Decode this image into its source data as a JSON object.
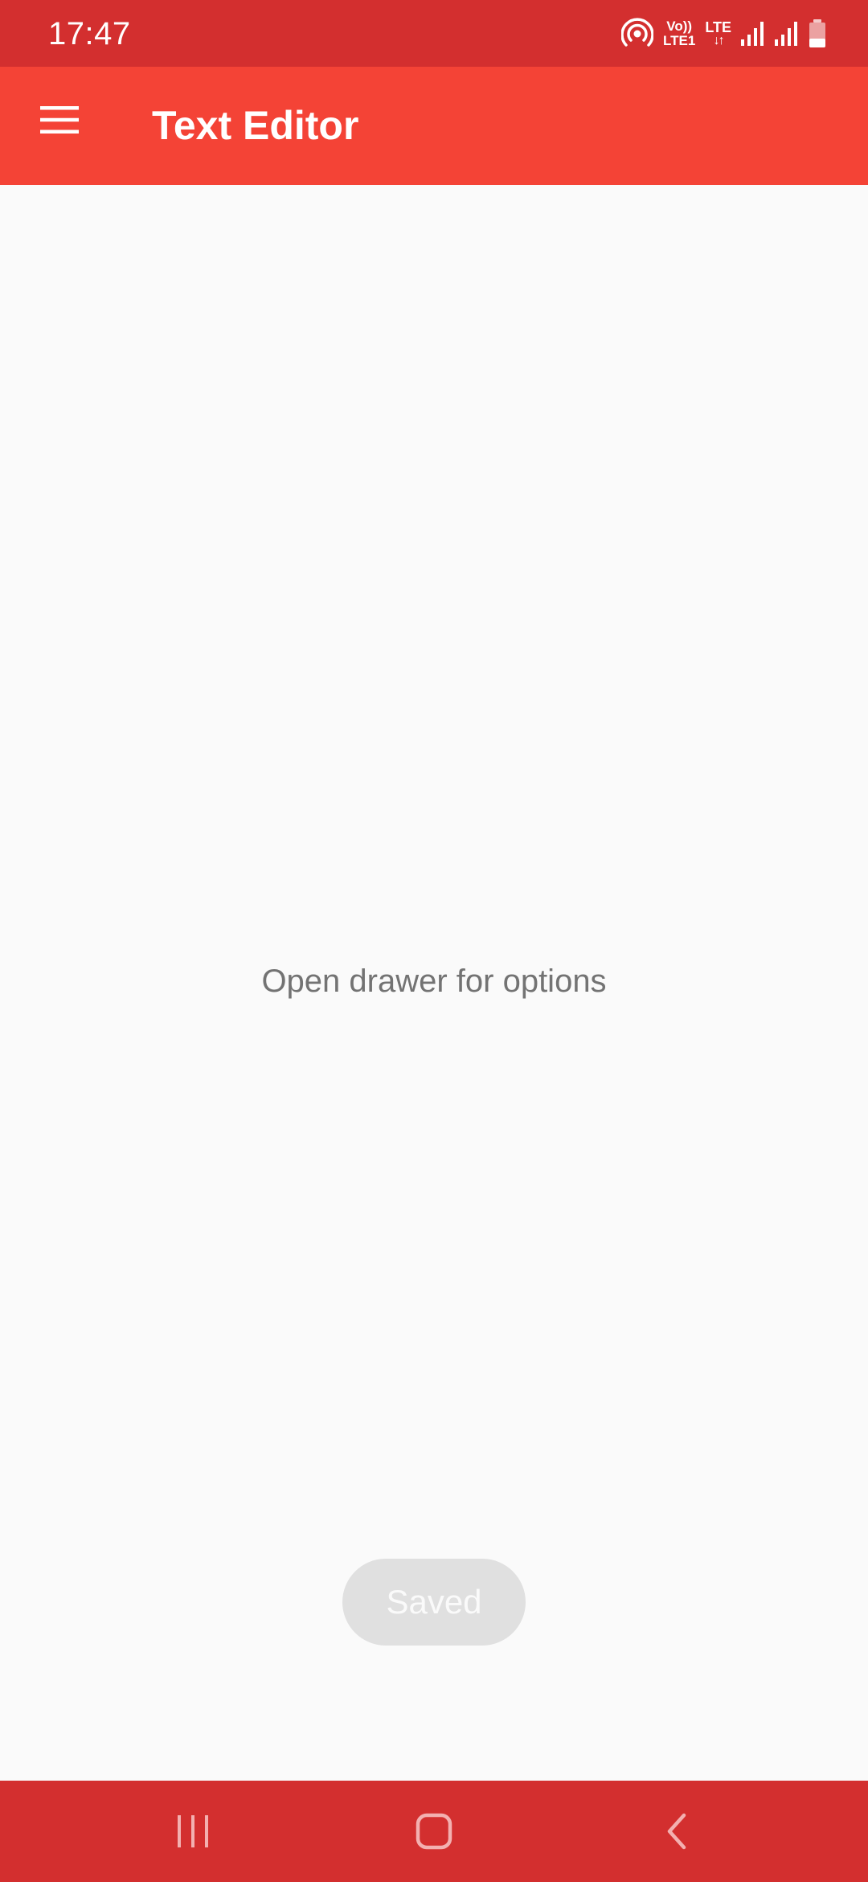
{
  "status_bar": {
    "time": "17:47",
    "icons": [
      "hotspot-icon",
      "volte-lte1-icon",
      "lte-data-icon",
      "signal-icon",
      "signal-icon",
      "battery-icon"
    ],
    "volte_top": "Vo))",
    "volte_bottom": "LTE1",
    "lte_label": "LTE",
    "lte_arrows": "↓↑"
  },
  "app_bar": {
    "menu_icon": "hamburger-menu-icon",
    "title": "Text Editor"
  },
  "content": {
    "hint": "Open drawer for options"
  },
  "toast": {
    "label": "Saved"
  },
  "nav_bar": {
    "buttons": [
      "recents-icon",
      "home-icon",
      "back-icon"
    ]
  },
  "colors": {
    "status_bar": "#d32f2f",
    "app_bar": "#f44336",
    "background": "#fafafa",
    "hint_text": "#737373",
    "toast_bg": "#e0e0e0",
    "toast_text": "#fafafa",
    "nav_bar": "#d32f2f"
  }
}
